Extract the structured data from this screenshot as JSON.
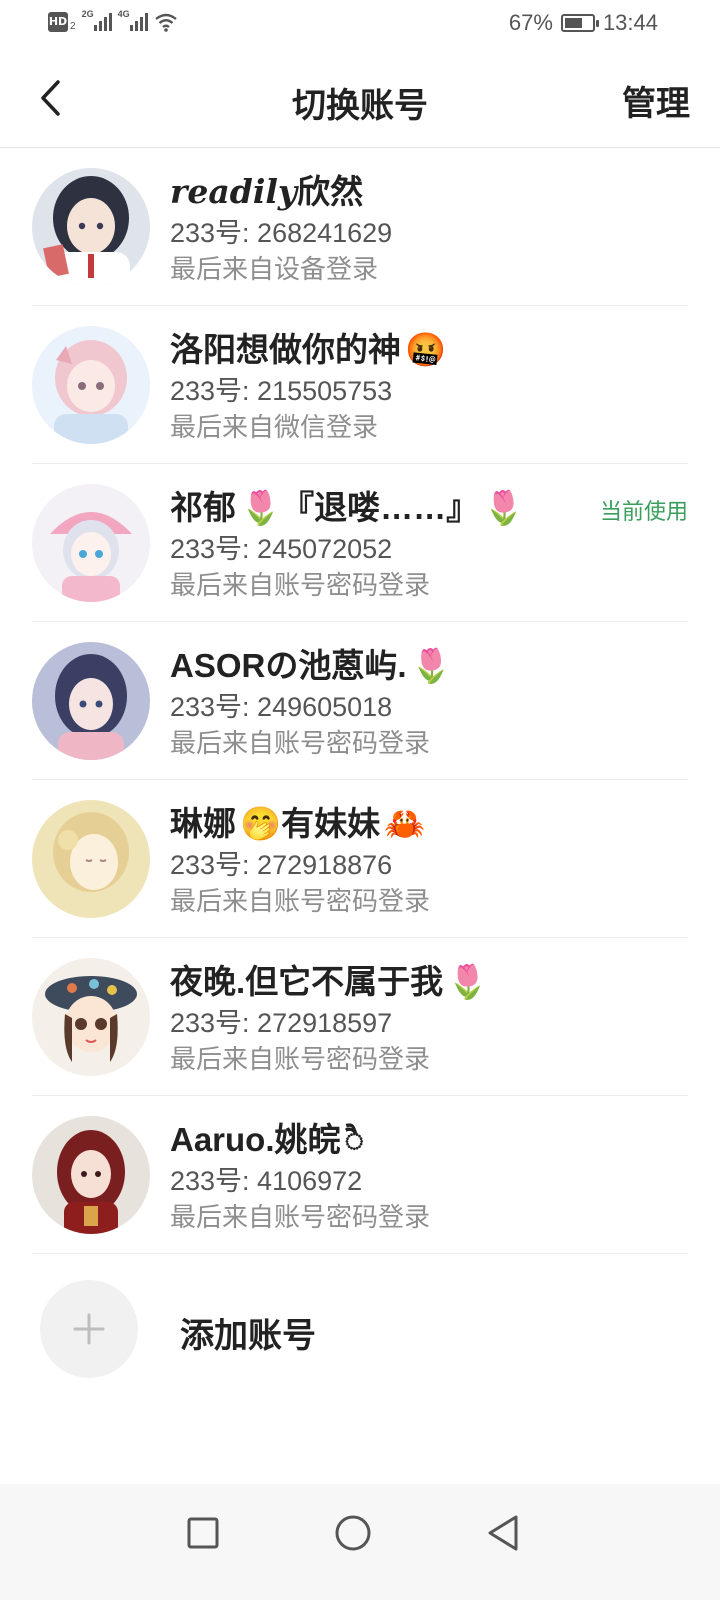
{
  "status_bar": {
    "hd_label": "HD",
    "hd_sub": "2",
    "net1": "2G",
    "net2": "4G",
    "battery_percent": "67%",
    "battery_level": 0.67,
    "time": "13:44"
  },
  "header": {
    "title": "切换账号",
    "manage_label": "管理"
  },
  "accounts": [
    {
      "name": "readily欣然",
      "name_italic_part": "readily",
      "name_rest": "欣然",
      "emoji": "",
      "id_text": "233号: 268241629",
      "login_text": "最后来自设备登录",
      "current": ""
    },
    {
      "name": "洛阳想做你的神",
      "emoji": "🤬",
      "id_text": "233号: 215505753",
      "login_text": "最后来自微信登录",
      "current": ""
    },
    {
      "name": "祁郁",
      "name_rest": "『退喽……』",
      "emoji": "🌷",
      "id_text": "233号: 245072052",
      "login_text": "最后来自账号密码登录",
      "current": "当前使用"
    },
    {
      "name": "ASORの池蒽屿.",
      "emoji": "🌷",
      "id_text": "233号: 249605018",
      "login_text": "最后来自账号密码登录",
      "current": ""
    },
    {
      "name": "琳娜",
      "name_rest": "有妹妹",
      "emoji": "🤭",
      "emoji2": "🦀",
      "id_text": "233号: 272918876",
      "login_text": "最后来自账号密码登录",
      "current": ""
    },
    {
      "name": "夜晚.但它不属于我",
      "emoji": "🌷",
      "id_text": "233号: 272918597",
      "login_text": "最后来自账号密码登录",
      "current": ""
    },
    {
      "name": "Aaruo.姚皖",
      "emoji": "ै",
      "id_text": "233号: 4106972",
      "login_text": "最后来自账号密码登录",
      "current": ""
    }
  ],
  "add_account": {
    "label": "添加账号"
  },
  "colors": {
    "current_badge": "#3a9e5c",
    "text_primary": "#222222",
    "text_secondary": "#555555",
    "text_tertiary": "#8e8e8e"
  }
}
